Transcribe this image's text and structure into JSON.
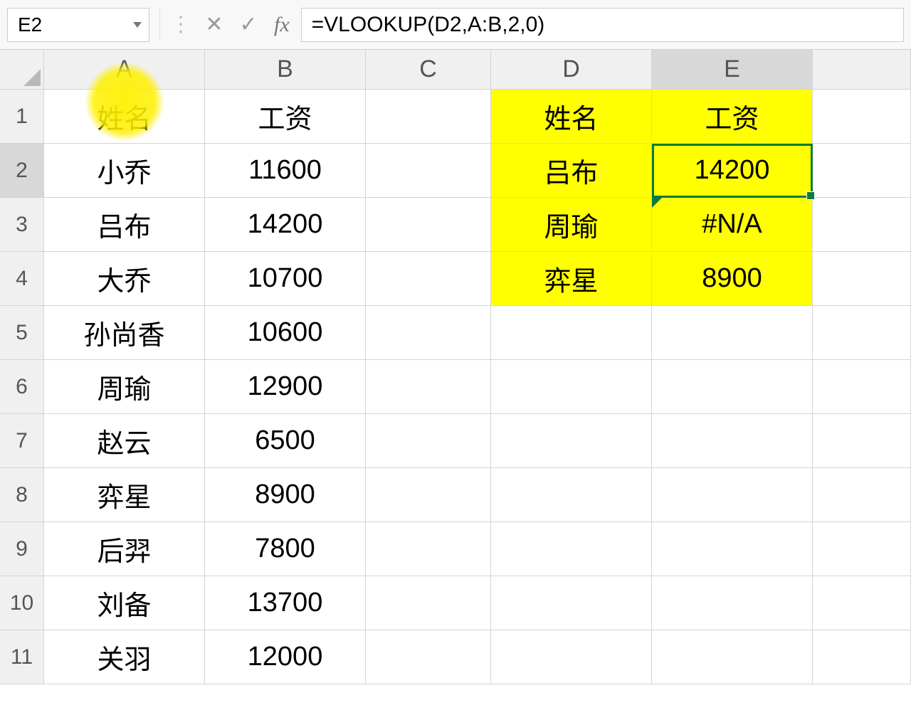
{
  "formula_bar": {
    "cell_ref": "E2",
    "formula": "=VLOOKUP(D2,A:B,2,0)",
    "fx_label": "fx",
    "cancel": "✕",
    "confirm": "✓",
    "dots": "⋮"
  },
  "columns": [
    "A",
    "B",
    "C",
    "D",
    "E",
    ""
  ],
  "rows": [
    "1",
    "2",
    "3",
    "4",
    "5",
    "6",
    "7",
    "8",
    "9",
    "10",
    "11"
  ],
  "cells": {
    "A1": "姓名",
    "B1": "工资",
    "D1": "姓名",
    "E1": "工资",
    "A2": "小乔",
    "B2": "11600",
    "D2": "吕布",
    "E2": "14200",
    "A3": "吕布",
    "B3": "14200",
    "D3": "周瑜",
    "E3": "#N/A",
    "A4": "大乔",
    "B4": "10700",
    "D4": "弈星",
    "E4": "8900",
    "A5": "孙尚香",
    "B5": "10600",
    "A6": "周瑜",
    "B6": "12900",
    "A7": "赵云",
    "B7": "6500",
    "A8": "弈星",
    "B8": "8900",
    "A9": "后羿",
    "B9": "7800",
    "A10": "刘备",
    "B10": "13700",
    "A11": "关羽",
    "B11": "12000"
  },
  "active_cell": "E2",
  "highlighted_region": "D1:E4"
}
